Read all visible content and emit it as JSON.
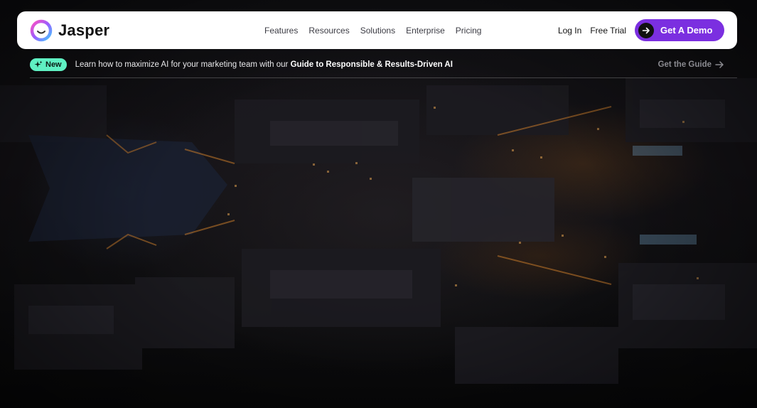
{
  "brand": {
    "name": "Jasper"
  },
  "nav": {
    "links": [
      "Features",
      "Resources",
      "Solutions",
      "Enterprise",
      "Pricing"
    ],
    "login": "Log In",
    "free_trial": "Free Trial",
    "demo_button": "Get A Demo"
  },
  "banner": {
    "badge": "New",
    "text": "Learn how to maximize AI for your marketing team with our ",
    "text_bold": "Guide to Responsible & Results-Driven AI",
    "link": "Get the Guide"
  },
  "colors": {
    "accent": "#7b2fe0",
    "badge": "#5ff0c3",
    "navbar": "#ffffff"
  },
  "icons": {
    "logo": "jasper-logo-icon",
    "badge": "sparkle-icon",
    "demo": "arrow-right-icon",
    "guide": "arrow-right-icon"
  }
}
